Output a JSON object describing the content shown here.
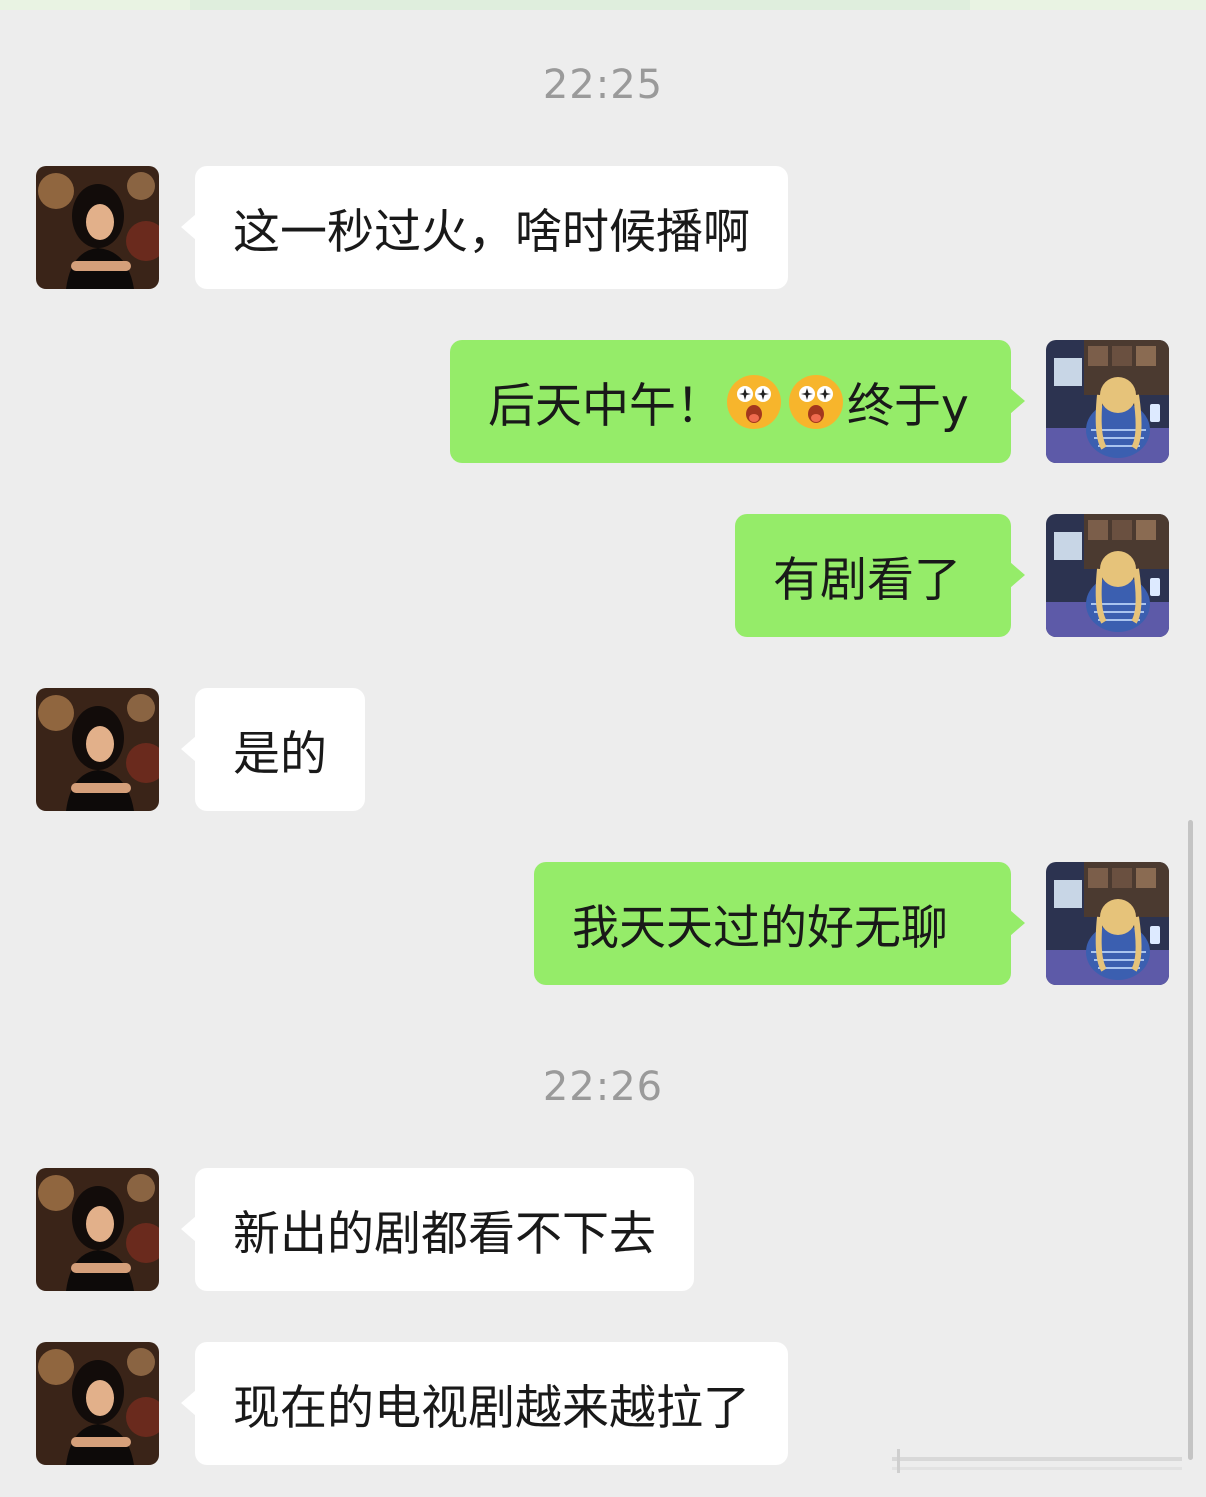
{
  "timestamps": [
    "22:25",
    "22:26"
  ],
  "messages": [
    {
      "side": "left",
      "text": "这一秒过火，啥时候播啊"
    },
    {
      "side": "right",
      "text_a": "后天中午！",
      "text_b": "终于y",
      "emoji": [
        "astonished-face-emoji",
        "astonished-face-emoji"
      ]
    },
    {
      "side": "right",
      "text": "有剧看了"
    },
    {
      "side": "left",
      "text": "是的"
    },
    {
      "side": "right",
      "text": "我天天过的好无聊"
    },
    {
      "side": "left",
      "text": "新出的剧都看不下去"
    },
    {
      "side": "left",
      "text": "现在的电视剧越来越拉了"
    }
  ],
  "colors": {
    "background": "#ededed",
    "incoming_bubble": "#ffffff",
    "outgoing_bubble": "#95ec69",
    "timestamp": "#9a9a9a"
  }
}
